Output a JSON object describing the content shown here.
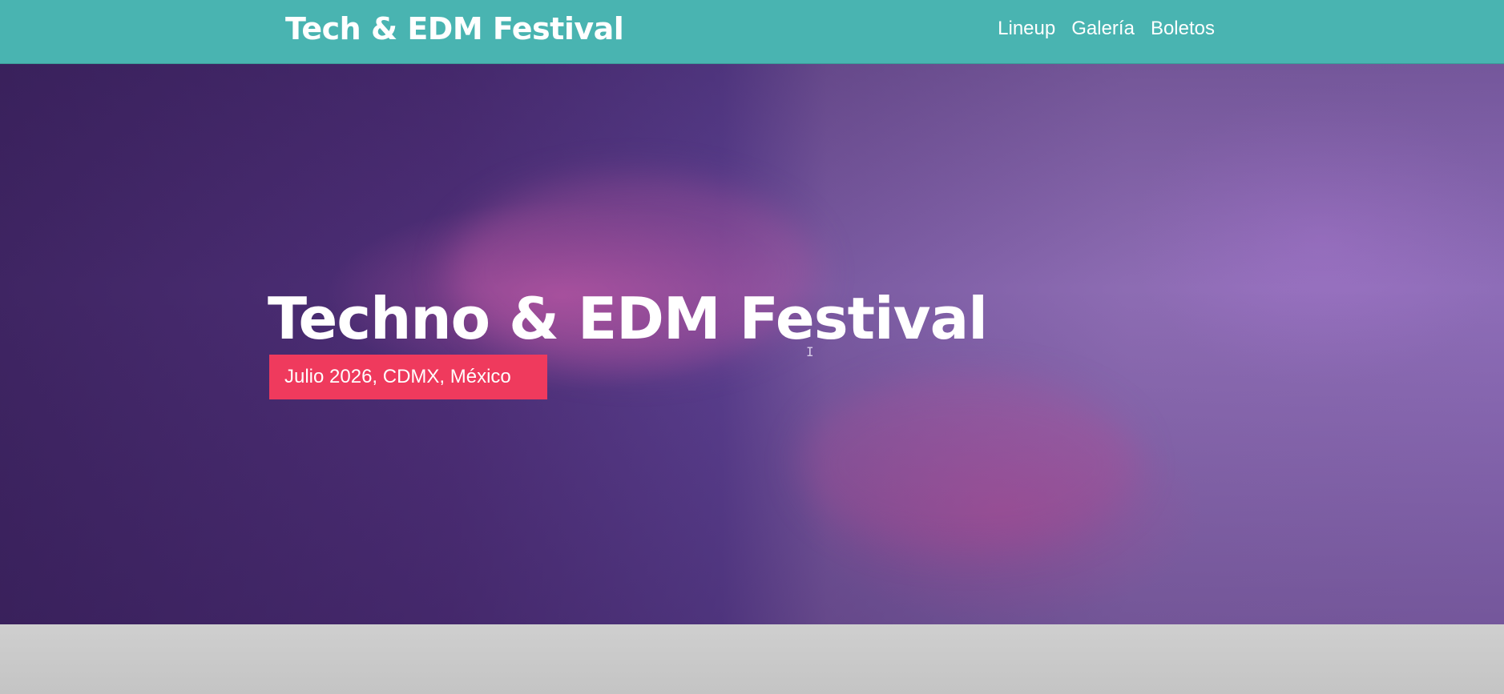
{
  "header": {
    "brand": "Tech & EDM Festival",
    "nav": [
      {
        "label": "Lineup"
      },
      {
        "label": "Galería"
      },
      {
        "label": "Boletos"
      }
    ]
  },
  "hero": {
    "title": "Techno & EDM Festival",
    "subtitle": "Julio 2026, CDMX, México"
  },
  "colors": {
    "header_bg": "#49b4b1",
    "accent_badge": "#ef3a5d",
    "hero_overlay": "#5b3f8f"
  }
}
